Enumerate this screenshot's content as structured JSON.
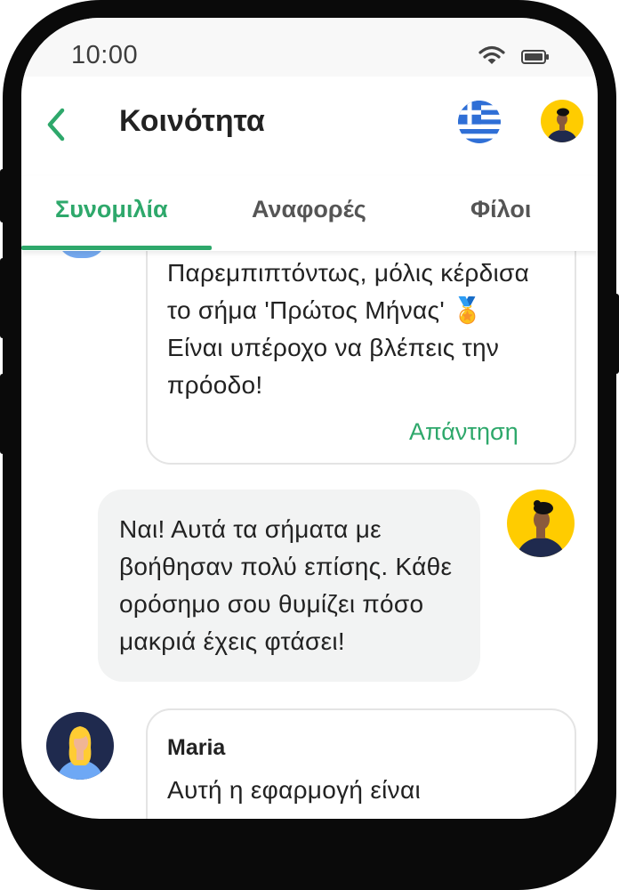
{
  "status_bar": {
    "time": "10:00"
  },
  "app_bar": {
    "title": "Κοινότητα",
    "language": "Greek"
  },
  "tabs": [
    {
      "label": "Συνομιλία",
      "active": true
    },
    {
      "label": "Αναφορές",
      "active": false
    },
    {
      "label": "Φίλοι",
      "active": false
    }
  ],
  "messages": [
    {
      "text": "Παρεμπιπτόντως, μόλις κέρδισα το σήμα 'Πρώτος Μήνας' 🏅 Είναι υπέροχο να βλέπεις την πρόοδο!",
      "reply_label": "Απάντηση"
    },
    {
      "text": "Ναι! Αυτά τα σήματα με βοήθησαν πολύ επίσης. Κάθε ορόσημο σου θυμίζει πόσο μακριά έχεις φτάσει!",
      "own": true
    },
    {
      "author": "Maria",
      "text": "Αυτή η εφαρμογή είναι"
    }
  ],
  "colors": {
    "accent": "#2ea86b",
    "bubble": "#f2f3f3",
    "avatar_yellow": "#ffcc00",
    "avatar_navy": "#1f2a4e"
  }
}
